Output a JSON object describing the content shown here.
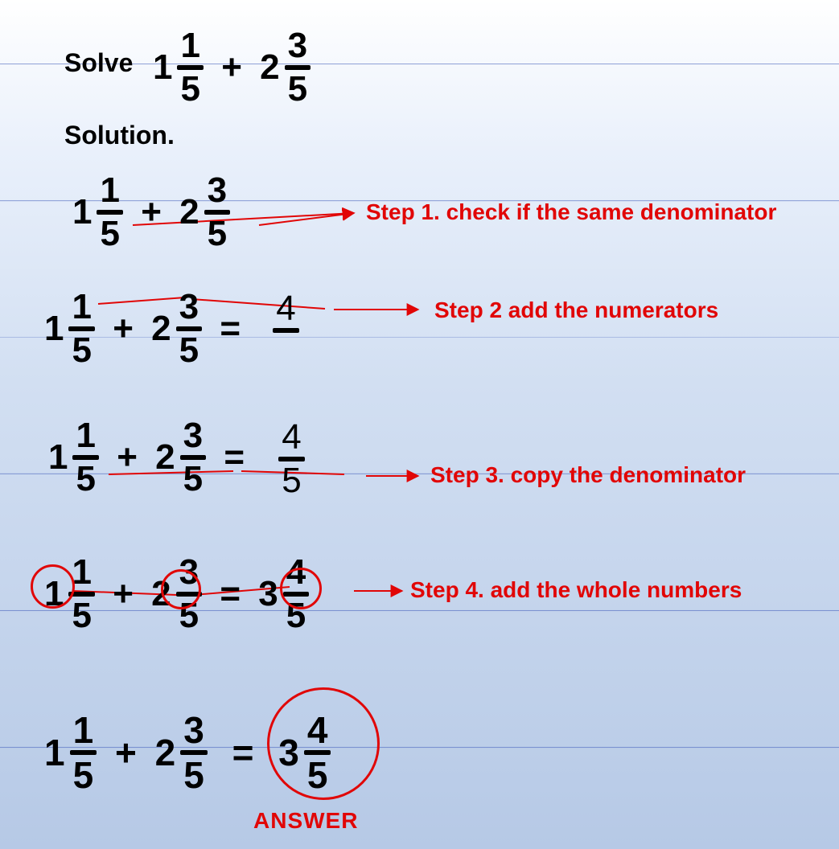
{
  "header": {
    "solve_label": "Solve",
    "solution_label": "Solution."
  },
  "problem": {
    "a_whole": "1",
    "a_num": "1",
    "a_den": "5",
    "plus": "+",
    "b_whole": "2",
    "b_num": "3",
    "b_den": "5"
  },
  "steps": {
    "s1": {
      "text": "Step 1. check if the same denominator"
    },
    "s2": {
      "text": "Step 2 add the numerators",
      "result_num": "4",
      "equals": "="
    },
    "s3": {
      "text": "Step 3. copy the denominator",
      "result_num": "4",
      "result_den": "5",
      "equals": "="
    },
    "s4": {
      "text": "Step 4. add the whole numbers",
      "result_whole": "3",
      "result_num": "4",
      "result_den": "5",
      "equals": "="
    }
  },
  "answer": {
    "equals": "=",
    "whole": "3",
    "num": "4",
    "den": "5",
    "label": "ANSWER"
  }
}
